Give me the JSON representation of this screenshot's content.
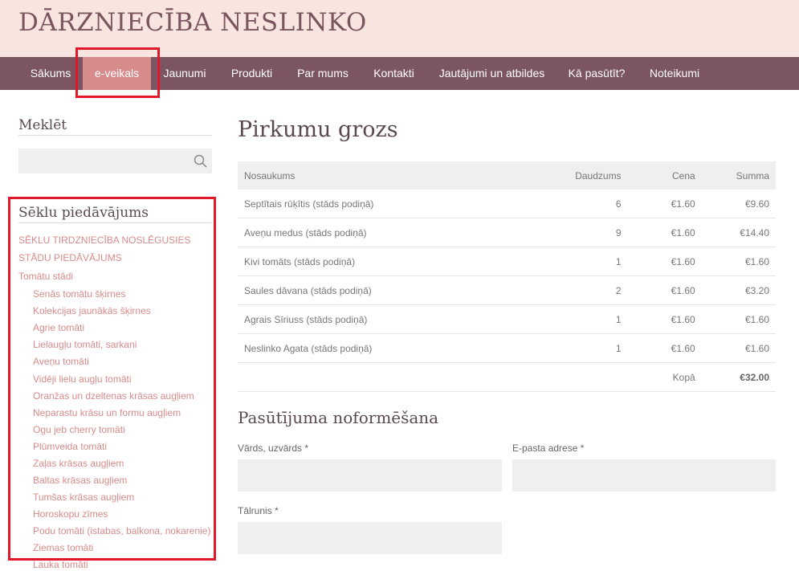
{
  "site": {
    "title": "DĀRZNIECĪBA NESLINKO"
  },
  "nav": {
    "items": [
      {
        "label": "Sākums"
      },
      {
        "label": "e-veikals",
        "active": true
      },
      {
        "label": "Jaunumi"
      },
      {
        "label": "Produkti"
      },
      {
        "label": "Par mums"
      },
      {
        "label": "Kontakti"
      },
      {
        "label": "Jautājumi un atbildes"
      },
      {
        "label": "Kā pasūtīt?"
      },
      {
        "label": "Noteikumi"
      }
    ]
  },
  "sidebar": {
    "search_heading": "Meklēt",
    "search_placeholder": "",
    "search_icon": "search-icon",
    "offers_heading": "Sēklu piedāvājums",
    "categories": [
      {
        "label": "SĒKLU TIRDZNIECĪBA NOSLĒGUSIES",
        "level": 0
      },
      {
        "label": "STĀDU PIEDĀVĀJUMS",
        "level": 0
      },
      {
        "label": "Tomātu stādi",
        "level": 0
      },
      {
        "label": "Senās tomātu šķirnes",
        "level": 1
      },
      {
        "label": "Kolekcijas jaunākās šķirnes",
        "level": 1
      },
      {
        "label": "Agrie tomāti",
        "level": 1
      },
      {
        "label": "Lielaugļu tomāti, sarkani",
        "level": 1
      },
      {
        "label": "Aveņu tomāti",
        "level": 1
      },
      {
        "label": "Vidēji lielu augļu tomāti",
        "level": 1
      },
      {
        "label": "Oranžas un dzeltenas krāsas augļiem",
        "level": 1
      },
      {
        "label": "Neparastu krāsu un formu augļiem",
        "level": 1
      },
      {
        "label": "Ogu jeb cherry tomāti",
        "level": 1
      },
      {
        "label": "Plūmveida tomāti",
        "level": 1
      },
      {
        "label": "Zaļas krāsas augļiem",
        "level": 1
      },
      {
        "label": "Baltas krāsas augļiem",
        "level": 1
      },
      {
        "label": "Tumšas krāsas augļiem",
        "level": 1
      },
      {
        "label": "Horoskopu zīmes",
        "level": 1
      },
      {
        "label": "Podu tomāti (istabas, balkona, nokarenie)",
        "level": 1
      },
      {
        "label": "Ziemas tomāti",
        "level": 1
      },
      {
        "label": "Lauka tomāti",
        "level": 1
      }
    ]
  },
  "cart": {
    "title": "Pirkumu grozs",
    "columns": [
      "Nosaukums",
      "Daudzums",
      "Cena",
      "Summa"
    ],
    "rows": [
      {
        "name": "Septītais rūķītis (stāds podiņā)",
        "qty": "6",
        "price": "€1.60",
        "sum": "€9.60"
      },
      {
        "name": "Aveņu medus (stāds podiņā)",
        "qty": "9",
        "price": "€1.60",
        "sum": "€14.40"
      },
      {
        "name": "Kivi tomāts (stāds podiņā)",
        "qty": "1",
        "price": "€1.60",
        "sum": "€1.60"
      },
      {
        "name": "Saules dāvana (stāds podiņā)",
        "qty": "2",
        "price": "€1.60",
        "sum": "€3.20"
      },
      {
        "name": "Agrais Sīriuss (stāds podiņā)",
        "qty": "1",
        "price": "€1.60",
        "sum": "€1.60"
      },
      {
        "name": "Neslinko Agata (stāds podiņā)",
        "qty": "1",
        "price": "€1.60",
        "sum": "€1.60"
      }
    ],
    "total_label": "Kopā",
    "total_value": "€32.00"
  },
  "order": {
    "title": "Pasūtījuma noformēšana",
    "name_label": "Vārds, uzvārds *",
    "name_value": "",
    "email_label": "E-pasta adrese *",
    "email_value": "",
    "phone_label": "Tālrunis *",
    "phone_value": ""
  },
  "colors": {
    "header_bg": "#f9e5df",
    "nav_bg": "#7b5561",
    "nav_active": "#d88b8b",
    "link": "#d88b8b",
    "highlight": "#e0182a"
  }
}
